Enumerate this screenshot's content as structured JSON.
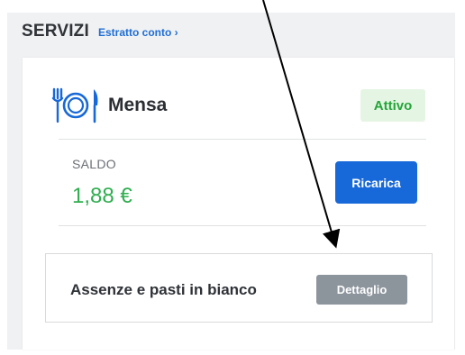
{
  "header": {
    "title": "SERVIZI",
    "link": "Estratto conto ›"
  },
  "service": {
    "name": "Mensa",
    "icon": "cutlery-icon",
    "status": "Attivo",
    "saldo_label": "SALDO",
    "saldo_value": "1,88 €",
    "ricarica_label": "Ricarica"
  },
  "assenze": {
    "label": "Assenze e pasti in bianco",
    "button_label": "Dettaglio"
  },
  "colors": {
    "accent_blue": "#1768d8",
    "status_green": "#24a53a",
    "balance_green": "#2fae4f",
    "button_gray": "#8c949c"
  }
}
